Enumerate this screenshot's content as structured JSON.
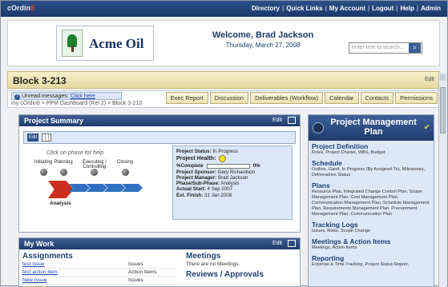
{
  "topbar": {
    "brand_prefix": "cOrdin",
    "brand_suffix": "8",
    "links": [
      "Directory",
      "Quick Links",
      "My Account",
      "Logout",
      "Help",
      "Admin"
    ]
  },
  "header": {
    "company": "Acme Oil",
    "welcome": "Welcome, Brad Jackson",
    "date": "Thursday, March 27, 2008",
    "search_placeholder": "enter text to search..."
  },
  "page": {
    "title": "Block 3-213",
    "edit_label": "Edit",
    "unread_prefix": "Unread messages:",
    "unread_link": "Click here",
    "breadcrumb": "my cOrdin8 > PPM Dashboard (Rel 2) > Block 3-213",
    "tabs": [
      "Exec Report",
      "Discussion",
      "Deliverables (Workflow)",
      "Calendar",
      "Contacts",
      "Permissions"
    ]
  },
  "summary": {
    "title": "Project Summary",
    "edit_label": "Edit",
    "edit_button": "Edit",
    "phase_help": "Click on phase for help",
    "phases": [
      "Initiating",
      "Planning",
      "Executing / Controlling",
      "Closing"
    ],
    "current_phase": "Analysis",
    "status_label": "Project Status:",
    "status_value": "In Progress",
    "health_label": "Project Health:",
    "health_color": "#f1e23a",
    "complete_label": "%Complete",
    "complete_value": "0%",
    "complete_fraction": 0,
    "sponsor_label": "Project Sponsor:",
    "sponsor_value": "Gary Richardson",
    "manager_label": "Project Manager:",
    "manager_value": "Brad Jackson",
    "phase_label": "Phase/Sub-Phase:",
    "phase_value": "Analysis",
    "start_label": "Actual Start:",
    "start_value": "4 Sep 2007",
    "finish_label": "Est. Finish:",
    "finish_value": "31 Jan 2008"
  },
  "pmplan": {
    "title": "Project Management Plan",
    "sections": [
      {
        "h": "Project Definition",
        "p": "Roles, Project Charter, WBS, Budget"
      },
      {
        "h": "Schedule",
        "p": "Outline, Gantt, In Progress (By Assigned To), Milestones, Deliverables Status"
      },
      {
        "h": "Plans",
        "p": "Resource Plan, Integrated Change Control Plan, Scope Management Plan, Cost Management Plan, Communication Management Plan, Schedule Management Plan, Requirements Management Plan, Procurement Management Plan, Communication Plan"
      },
      {
        "h": "Tracking Logs",
        "p": "Issues, Risks, Scope Change"
      },
      {
        "h": "Meetings & Action Items",
        "p": "Meetings, Action Items"
      },
      {
        "h": "Reporting",
        "p": "Expense & Time Tracking, Project Status Report,"
      }
    ]
  },
  "mywork": {
    "title": "My Work",
    "edit_label": "Edit",
    "assignments_title": "Assignments",
    "assignments": [
      {
        "title": "test issue",
        "kind": "Issues"
      },
      {
        "title": "test action item",
        "kind": "Action Items"
      },
      {
        "title": "New Issue",
        "kind": "Issues"
      }
    ],
    "meetings_title": "Meetings",
    "meetings_text": "There are no Meetings.",
    "reviews_title": "Reviews / Approvals"
  },
  "colors": {
    "accent": "#2c4f8a",
    "title_band": "#ece1ae",
    "arrow": "#2f6fbf",
    "current_phase": "#cc2f20"
  }
}
